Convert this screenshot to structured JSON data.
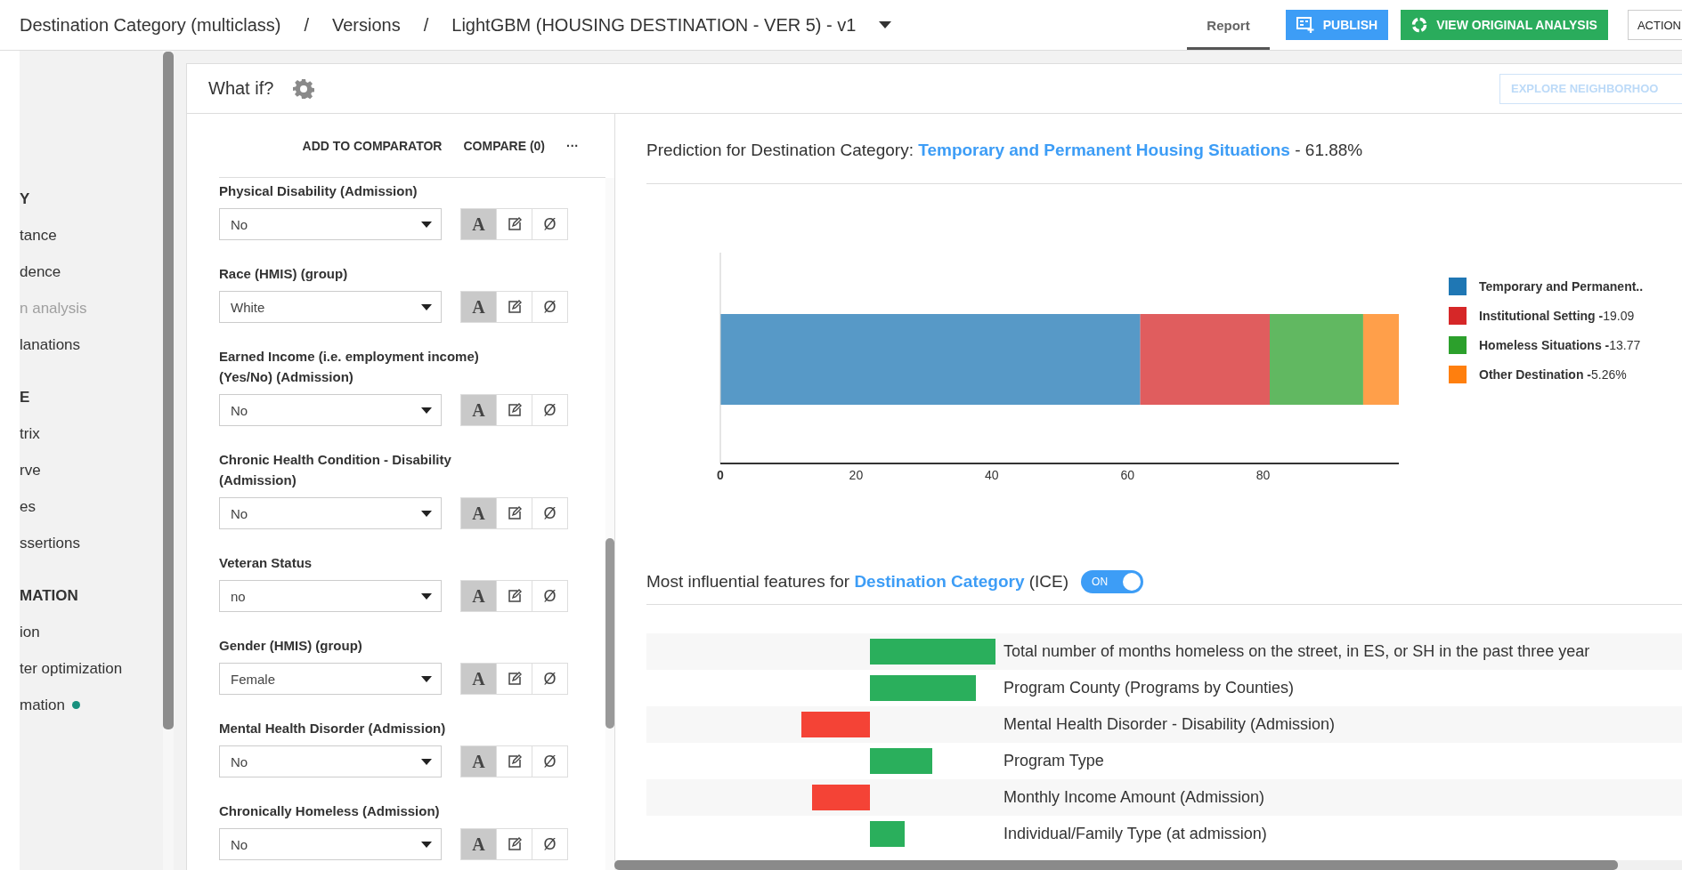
{
  "breadcrumb": [
    {
      "kind": "crumb",
      "text": "Destination Category (multiclass)"
    },
    {
      "kind": "separator",
      "text": "/"
    },
    {
      "kind": "crumb",
      "text": "Versions"
    },
    {
      "kind": "separator",
      "text": "/"
    },
    {
      "kind": "crumb",
      "text": "LightGBM (HOUSING DESTINATION - VER 5) - v1"
    }
  ],
  "header_actions": {
    "report_tab": {
      "label": "Report",
      "selected": true
    },
    "publish": "PUBLISH",
    "view_original": "VIEW ORIGINAL ANALYSIS",
    "actions": "ACTION"
  },
  "sidebar": {
    "items": [
      {
        "kind": "header",
        "label": "Y",
        "disabled": false,
        "dot": false
      },
      {
        "kind": "item",
        "label": "tance",
        "disabled": false,
        "dot": false
      },
      {
        "kind": "item",
        "label": "dence",
        "disabled": false,
        "dot": false
      },
      {
        "kind": "item",
        "label": "n analysis",
        "disabled": true,
        "dot": false
      },
      {
        "kind": "item",
        "label": "lanations",
        "disabled": false,
        "dot": false
      },
      {
        "kind": "header",
        "label": "E",
        "disabled": false,
        "dot": false
      },
      {
        "kind": "item",
        "label": "trix",
        "disabled": false,
        "dot": false
      },
      {
        "kind": "item",
        "label": "rve",
        "disabled": false,
        "dot": false
      },
      {
        "kind": "item",
        "label": "es",
        "disabled": false,
        "dot": false
      },
      {
        "kind": "item",
        "label": "ssertions",
        "disabled": false,
        "dot": false
      },
      {
        "kind": "header",
        "label": "MATION",
        "disabled": false,
        "dot": false
      },
      {
        "kind": "item",
        "label": "ion",
        "disabled": false,
        "dot": false
      },
      {
        "kind": "item",
        "label": "ter optimization",
        "disabled": false,
        "dot": false
      },
      {
        "kind": "item",
        "label": "mation",
        "disabled": false,
        "dot": true
      }
    ]
  },
  "what_if": {
    "title": "What if?",
    "explore_button": {
      "label": "EXPLORE NEIGHBORHOO",
      "disabled": true
    },
    "toolbar": [
      "ADD TO COMPARATOR",
      "COMPARE (0)",
      "···"
    ],
    "fields": [
      {
        "label": "Physical Disability (Admission)",
        "value": "No",
        "modes": [
          {
            "kind": "text",
            "label": "A",
            "selected": true
          },
          {
            "kind": "edit",
            "selected": false
          },
          {
            "kind": "text",
            "label": "Ø",
            "selected": false
          }
        ]
      },
      {
        "label": "Race (HMIS) (group)",
        "value": "White",
        "modes": [
          {
            "kind": "text",
            "label": "A",
            "selected": true
          },
          {
            "kind": "edit",
            "selected": false
          },
          {
            "kind": "text",
            "label": "Ø",
            "selected": false
          }
        ]
      },
      {
        "label": "Earned Income (i.e. employment income) (Yes/No) (Admission)",
        "value": "No",
        "modes": [
          {
            "kind": "text",
            "label": "A",
            "selected": true
          },
          {
            "kind": "edit",
            "selected": false
          },
          {
            "kind": "text",
            "label": "Ø",
            "selected": false
          }
        ]
      },
      {
        "label": "Chronic Health Condition - Disability (Admission)",
        "value": "No",
        "modes": [
          {
            "kind": "text",
            "label": "A",
            "selected": true
          },
          {
            "kind": "edit",
            "selected": false
          },
          {
            "kind": "text",
            "label": "Ø",
            "selected": false
          }
        ]
      },
      {
        "label": "Veteran Status",
        "value": "no",
        "modes": [
          {
            "kind": "text",
            "label": "A",
            "selected": true
          },
          {
            "kind": "edit",
            "selected": false
          },
          {
            "kind": "text",
            "label": "Ø",
            "selected": false
          }
        ]
      },
      {
        "label": "Gender (HMIS) (group)",
        "value": "Female",
        "modes": [
          {
            "kind": "text",
            "label": "A",
            "selected": true
          },
          {
            "kind": "edit",
            "selected": false
          },
          {
            "kind": "text",
            "label": "Ø",
            "selected": false
          }
        ]
      },
      {
        "label": "Mental Health Disorder (Admission)",
        "value": "No",
        "modes": [
          {
            "kind": "text",
            "label": "A",
            "selected": true
          },
          {
            "kind": "edit",
            "selected": false
          },
          {
            "kind": "text",
            "label": "Ø",
            "selected": false
          }
        ]
      },
      {
        "label": "Chronically Homeless (Admission)",
        "value": "No",
        "modes": [
          {
            "kind": "text",
            "label": "A",
            "selected": true
          },
          {
            "kind": "edit",
            "selected": false
          },
          {
            "kind": "text",
            "label": "Ø",
            "selected": false
          }
        ]
      }
    ]
  },
  "prediction": {
    "prefix": "Prediction for Destination Category:",
    "outcome": "Temporary and Permanent Housing Situations",
    "probability": "- 61.88%",
    "chart_data": {
      "type": "bar",
      "orientation": "horizontal",
      "stacked": true,
      "xlim": [
        0,
        100
      ],
      "xticks": [
        0,
        20,
        40,
        60,
        80
      ],
      "series": [
        {
          "color": "#1f77b4",
          "values": [
            61.88
          ]
        },
        {
          "color": "#d62728",
          "values": [
            19.09
          ]
        },
        {
          "color": "#2ca02c",
          "values": [
            13.77
          ]
        },
        {
          "color": "#ff7f0e",
          "values": [
            5.26
          ]
        }
      ]
    },
    "legend": [
      {
        "name": "Temporary and Permanent..",
        "color": "#1f77b4"
      },
      {
        "name": "Institutional Setting -",
        "reading": "19.09",
        "color": "#d62728"
      },
      {
        "name": "Homeless Situations -",
        "reading": "13.77",
        "color": "#2ca02c"
      },
      {
        "name": "Other Destination -",
        "reading": "5.26%",
        "color": "#ff7f0e"
      }
    ]
  },
  "features": {
    "prefix": "Most influential features for",
    "target": "Destination Category",
    "suffix": "(ICE)",
    "toggle": {
      "label": "ON",
      "on": true
    },
    "rows": [
      {
        "label": "Total number of months homeless on the street, in ES, or SH in the past three year",
        "kind": "positive"
      },
      {
        "label": "Program County (Programs by Counties)",
        "kind": "positive"
      },
      {
        "label": "Mental Health Disorder - Disability (Admission)",
        "kind": "negative"
      },
      {
        "label": "Program Type",
        "kind": "positive"
      },
      {
        "label": "Monthly Income Amount (Admission)",
        "kind": "negative"
      },
      {
        "label": "Individual/Family Type (at admission)",
        "kind": "positive"
      }
    ]
  }
}
